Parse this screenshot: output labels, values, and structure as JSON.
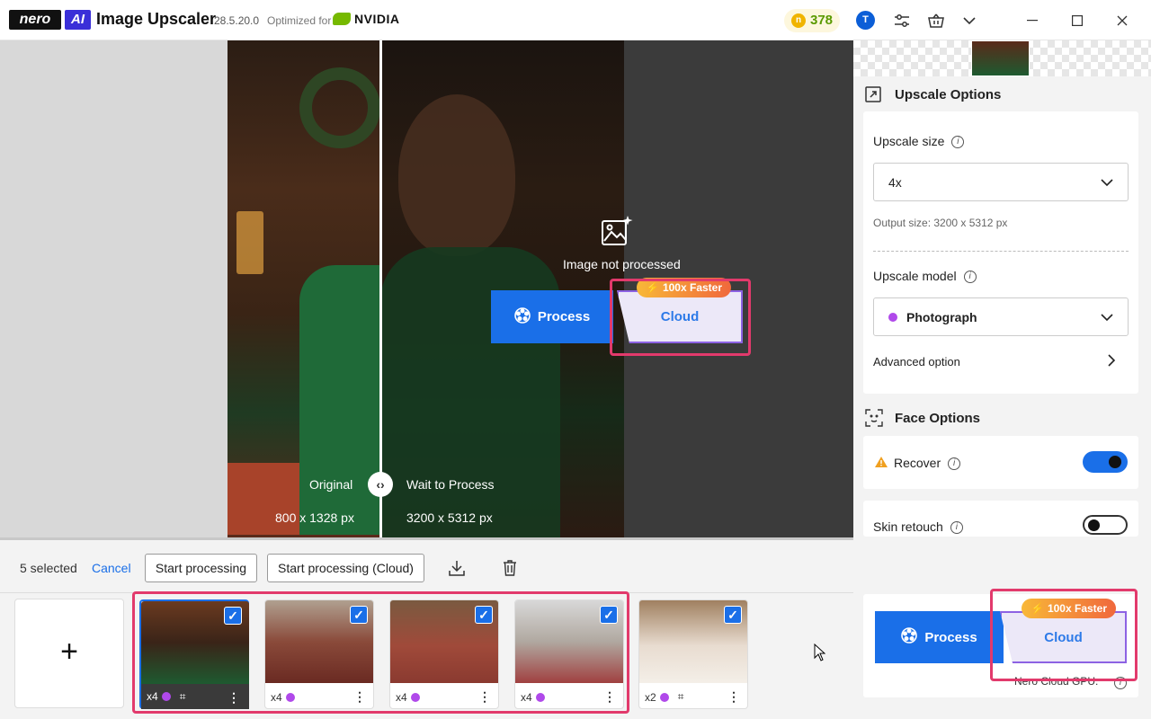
{
  "titlebar": {
    "brand": "nero",
    "brand_ai": "AI",
    "title": "Image Upscaler",
    "version": "28.5.20.0",
    "optimized_for": "Optimized for",
    "partner": "NVIDIA",
    "credits": "378",
    "avatar_initial": "T"
  },
  "preview": {
    "not_processed": "Image not processed",
    "original_label": "Original",
    "original_size": "800 x 1328 px",
    "wait_label": "Wait to Process",
    "output_size": "3200 x 5312 px",
    "process_label": "Process",
    "cloud_label": "Cloud",
    "faster_badge": "100x Faster"
  },
  "toolbar": {
    "selected": "5 selected",
    "cancel": "Cancel",
    "start": "Start processing",
    "start_cloud": "Start processing (Cloud)"
  },
  "thumbnails": [
    {
      "scale": "x4",
      "face": true,
      "checked": true
    },
    {
      "scale": "x4",
      "face": false,
      "checked": true
    },
    {
      "scale": "x4",
      "face": false,
      "checked": true
    },
    {
      "scale": "x4",
      "face": false,
      "checked": true
    },
    {
      "scale": "x2",
      "face": true,
      "checked": true
    }
  ],
  "upscale_options": {
    "title": "Upscale Options",
    "size_label": "Upscale size",
    "size_value": "4x",
    "output_size": "Output size: 3200 x 5312 px",
    "model_label": "Upscale model",
    "model_value": "Photograph",
    "advanced": "Advanced option"
  },
  "face_options": {
    "title": "Face Options",
    "recover": "Recover",
    "recover_on": true,
    "skin_retouch": "Skin retouch",
    "skin_on": false
  },
  "bottom_panel": {
    "process_label": "Process",
    "cloud_label": "Cloud",
    "faster_badge": "100x Faster",
    "gpu_label": "Nero Cloud GPU:"
  },
  "colors": {
    "accent": "#1a6fe8",
    "highlight": "#e23a6c",
    "model_dot": "#b049ea",
    "cloud_border": "#8d62e3"
  }
}
